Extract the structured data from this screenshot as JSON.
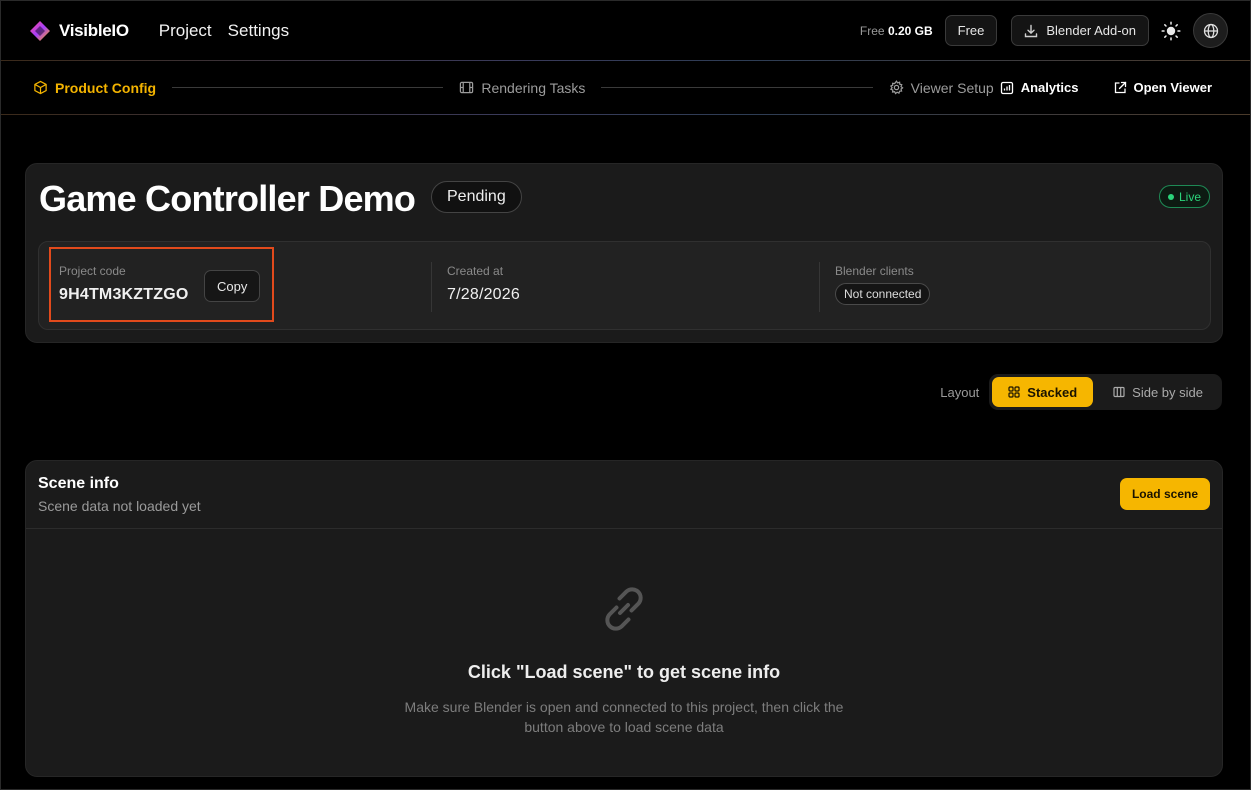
{
  "app": {
    "brand": "VisibleIO",
    "nav": [
      "Project",
      "Settings"
    ],
    "storage_prefix": "Free",
    "storage_value": "0.20 GB",
    "plan_label": "Free",
    "addon_label": "Blender Add-on"
  },
  "workflow": {
    "steps": [
      "Product Config",
      "Rendering Tasks",
      "Viewer Setup"
    ],
    "analytics": "Analytics",
    "open_viewer": "Open Viewer"
  },
  "project": {
    "title": "Game Controller Demo",
    "status": "Pending",
    "live": "Live",
    "code_label": "Project code",
    "code_value": "9H4TM3KZTZGO",
    "copy_label": "Copy",
    "created_label": "Created at",
    "created_value": "7/28/2026",
    "clients_label": "Blender clients",
    "clients_value": "Not connected"
  },
  "layout": {
    "label": "Layout",
    "options": [
      "Stacked",
      "Side by side"
    ],
    "selected": "Stacked"
  },
  "scene": {
    "title": "Scene info",
    "subtitle": "Scene data not loaded yet",
    "load_label": "Load scene",
    "empty_title": "Click \"Load scene\" to get scene info",
    "empty_desc": "Make sure Blender is open and connected to this project, then click the button above to load scene data"
  },
  "colors": {
    "accent": "#f6b600",
    "live": "#2bd37a",
    "highlight": "#e24a1c"
  }
}
